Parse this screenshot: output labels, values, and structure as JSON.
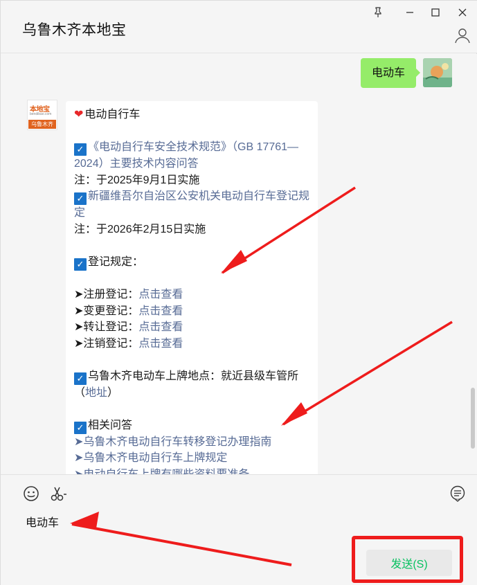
{
  "window": {
    "title": "乌鲁木齐本地宝",
    "controls": [
      "pin-icon",
      "minimize-icon",
      "maximize-icon",
      "close-icon"
    ]
  },
  "chat": {
    "my_message": "电动车",
    "bot_avatar": {
      "logo_text": "本地宝",
      "logo_url": "bendibao.com",
      "logo_bar": "乌鲁木齐"
    },
    "bot_message": {
      "heading": "电动自行车",
      "std_link": "《电动自行车安全技术规范》（GB 17761—2024）主要技术内容问答",
      "std_note": "注：于2025年9月1日实施",
      "reg_link": "新疆维吾尔自治区公安机关电动自行车登记规定",
      "reg_note": "注：于2026年2月15日实施",
      "reg_title": "登记规定：",
      "items": [
        {
          "label": "➤注册登记：",
          "link": "点击查看"
        },
        {
          "label": "➤变更登记：",
          "link": "点击查看"
        },
        {
          "label": "➤转让登记：",
          "link": "点击查看"
        },
        {
          "label": "➤注销登记：",
          "link": "点击查看"
        }
      ],
      "place_text": "乌鲁木齐电动车上牌地点：就近县级车管所（",
      "place_link": "地址",
      "place_end": "）",
      "qa_title": "相关问答",
      "qa_links": [
        "➤乌鲁木齐电动自行车转移登记办理指南",
        "➤乌鲁木齐电动自行车上牌规定",
        "➤电动自行车上牌有哪些资料要准备"
      ]
    }
  },
  "input": {
    "value": "电动车",
    "send_label": "发送(S)"
  },
  "colors": {
    "bubble_mine": "#95ec69",
    "link": "#576b95",
    "send_text": "#07c160",
    "annotation": "#ee1c1c"
  }
}
